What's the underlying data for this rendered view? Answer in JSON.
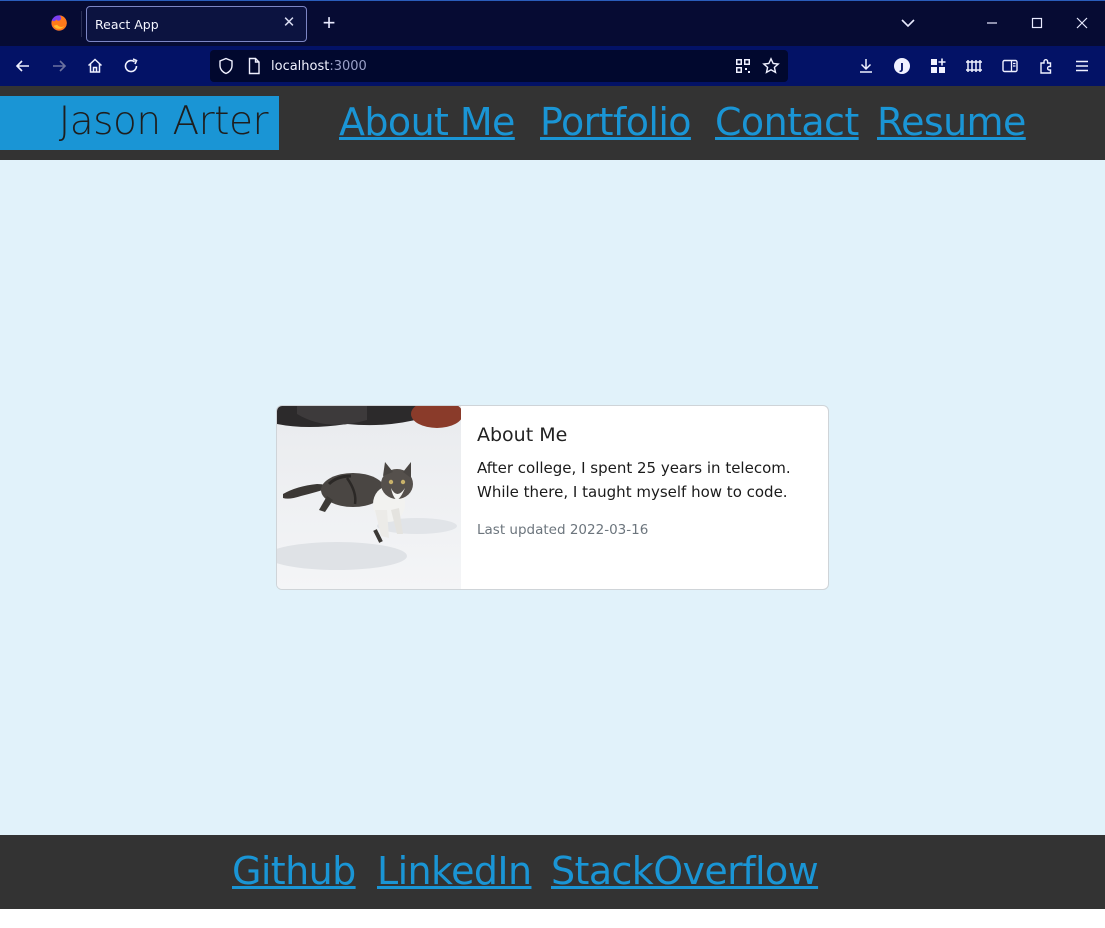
{
  "browser": {
    "tab_title": "React App",
    "url_host": "localhost",
    "url_port": ":3000",
    "colors": {
      "tabbar": "#060b33",
      "navbar": "#031266",
      "urlbar": "#01082e"
    }
  },
  "header": {
    "brand": "Jason Arter",
    "nav": [
      "About Me",
      "Portfolio",
      "Contact",
      "Resume"
    ]
  },
  "card": {
    "title": "About Me",
    "text": "After college, I spent 25 years in telecom. While there, I taught myself how to code.",
    "updated": "Last updated 2022-03-16",
    "image": "cat-in-snow-photo"
  },
  "footer": {
    "links": [
      "Github",
      "LinkedIn",
      "StackOverflow"
    ]
  },
  "colors": {
    "accent": "#1a95d5",
    "header_bg": "#333333",
    "main_bg": "#e1f2fa"
  }
}
